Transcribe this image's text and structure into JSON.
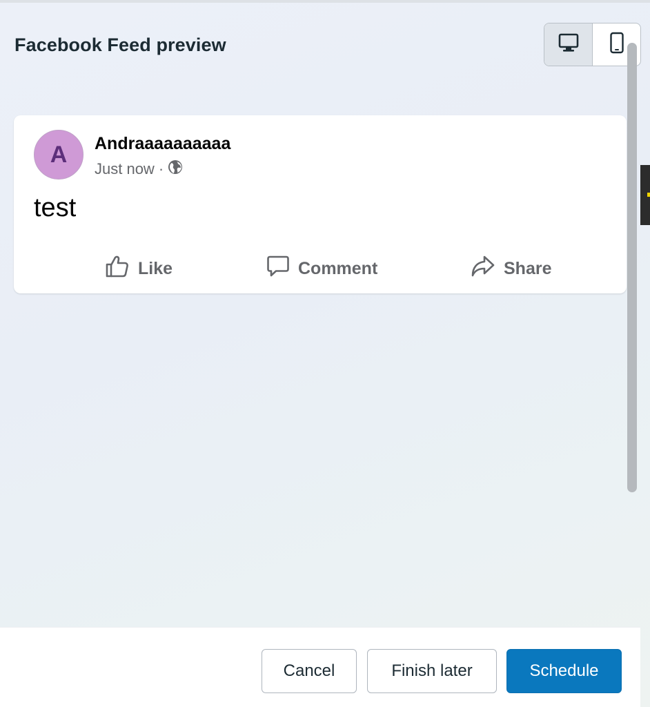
{
  "header": {
    "title": "Facebook Feed preview",
    "view_toggle": {
      "options": [
        {
          "icon": "desktop-icon",
          "active": true
        },
        {
          "icon": "mobile-icon",
          "active": false
        }
      ]
    }
  },
  "post": {
    "avatar_initial": "A",
    "author": "Andraaaaaaaaaa",
    "timestamp": "Just now",
    "separator": "·",
    "privacy_icon": "globe-icon",
    "text": "test",
    "actions": {
      "like": "Like",
      "comment": "Comment",
      "share": "Share"
    }
  },
  "footer": {
    "cancel": "Cancel",
    "finish_later": "Finish later",
    "schedule": "Schedule"
  },
  "colors": {
    "primary": "#0a78be",
    "avatar_bg": "#cf9ad6",
    "avatar_text": "#5c2e7a"
  }
}
